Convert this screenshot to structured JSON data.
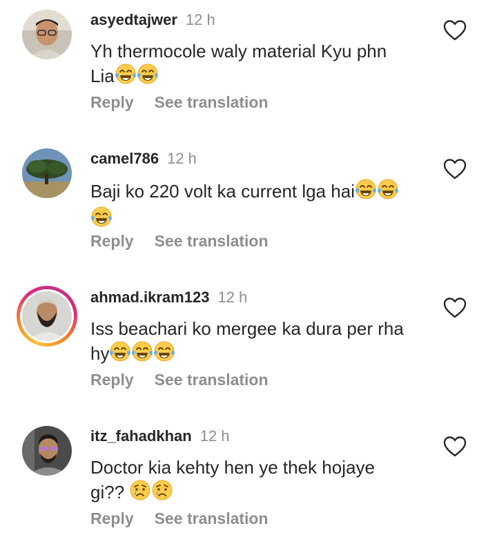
{
  "comments": [
    {
      "username": "asyedtajwer",
      "time": "12 h",
      "text_line1": "Yh thermocole waly material Kyu phn",
      "text_line2": "Lia",
      "reply_label": "Reply",
      "translate_label": "See translation"
    },
    {
      "username": "camel786",
      "time": "12 h",
      "text_line1": "Baji ko 220 volt ka current lga hai",
      "text_line2": "",
      "reply_label": "Reply",
      "translate_label": "See translation"
    },
    {
      "username": "ahmad.ikram123",
      "time": "12 h",
      "text_line1": "Iss beachari ko mergee ka dura per rha",
      "text_line2": "hy",
      "reply_label": "Reply",
      "translate_label": "See translation"
    },
    {
      "username": "itz_fahadkhan",
      "time": "12 h",
      "text_line1": "Doctor kia kehty hen ye thek hojaye",
      "text_line2": "gi??",
      "reply_label": "Reply",
      "translate_label": "See translation"
    }
  ],
  "icons": {
    "like": "heart-outline-icon",
    "laugh": "face-with-tears-of-joy-emoji",
    "cry": "crying-face-emoji"
  },
  "colors": {
    "text": "#262626",
    "secondary": "#8e8e8e",
    "story_ring_start": "#f58529",
    "story_ring_end": "#dd2a7b"
  }
}
